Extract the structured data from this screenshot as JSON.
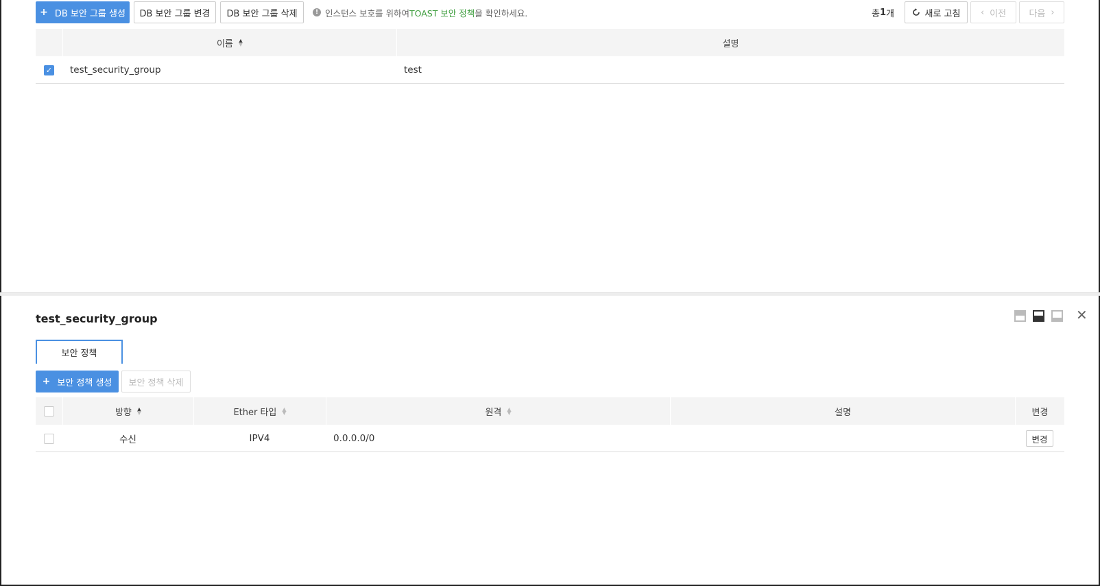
{
  "toolbar": {
    "create_label": "DB 보안 그룹 생성",
    "edit_label": "DB 보안 그룹 변경",
    "delete_label": "DB 보안 그룹 삭제",
    "info_prefix": "인스턴스 보호를 위하여 ",
    "info_link": "TOAST 보안 정책",
    "info_suffix": "을 확인하세요.",
    "total_prefix": "총",
    "total_count": "1",
    "total_suffix": "개",
    "refresh_label": "새로 고침",
    "prev_label": "이전",
    "next_label": "다음"
  },
  "group_table": {
    "columns": [
      "이름",
      "설명"
    ],
    "rows": [
      {
        "name": "test_security_group",
        "description": "test",
        "checked": true
      }
    ]
  },
  "detail": {
    "title": "test_security_group",
    "tab_label": "보안 정책",
    "create_rule_label": "보안 정책 생성",
    "delete_rule_label": "보안 정책 삭제",
    "rule_columns": [
      "방향",
      "Ether 타입",
      "원격",
      "설명",
      "변경"
    ],
    "rules": [
      {
        "direction": "수신",
        "ether_type": "IPV4",
        "remote": "0.0.0.0/0",
        "description": "",
        "edit_label": "변경"
      }
    ]
  },
  "icons": {
    "info": "info-icon",
    "refresh": "refresh-icon",
    "close": "close-icon",
    "layout": [
      "layout-top-icon",
      "layout-split-icon",
      "layout-bottom-icon"
    ]
  },
  "colors": {
    "primary": "#4a90e2",
    "link_green": "#3d9d3d"
  }
}
